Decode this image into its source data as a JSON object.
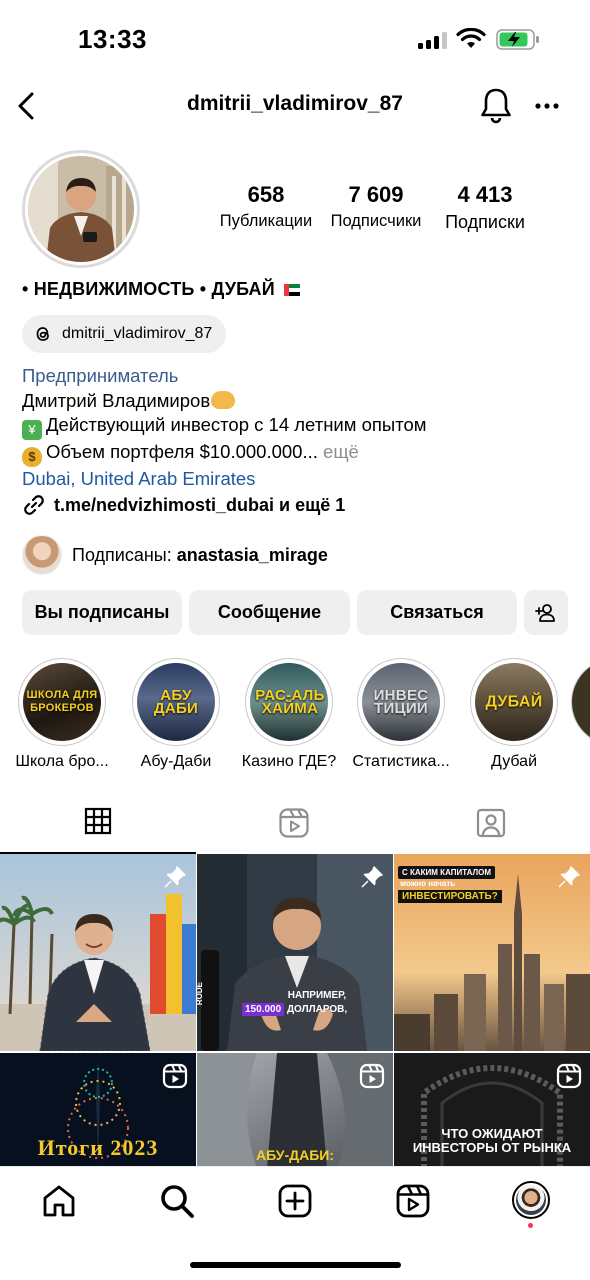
{
  "status_bar": {
    "time": "13:33"
  },
  "header": {
    "username": "dmitrii_vladimirov_87",
    "icons": [
      "back-arrow-icon",
      "bell-icon",
      "more-horizontal-icon"
    ]
  },
  "profile": {
    "stats": [
      {
        "count": "658",
        "label": "Публикации"
      },
      {
        "count": "7 609",
        "label": "Подписчики"
      },
      {
        "count": "4 413",
        "label": "Подписки"
      }
    ],
    "title": "• НЕДВИЖИМОСТЬ • ДУБАЙ",
    "threads_handle": "dmitrii_vladimirov_87",
    "category": "Предприниматель",
    "bio_line1": "Дмитрий Владимиров",
    "bio_line2": "Действующий инвестор с 14 летним опытом",
    "bio_line3": "Объем портфеля $10.000.000...",
    "bio_more": " ещё",
    "location": "Dubai, United Arab Emirates",
    "link": "t.me/nedvizhimosti_dubai и ещё 1",
    "followed_prefix": "Подписаны: ",
    "followed_user": "anastasia_mirage"
  },
  "actions": {
    "following": "Вы подписаны",
    "message": "Сообщение",
    "contact": "Связаться",
    "add_person_icon": "add-person-icon"
  },
  "highlights": [
    {
      "label": "Школа бро...",
      "cover": "ШКОЛА ДЛЯ БРОКЕРОВ"
    },
    {
      "label": "Абу-Даби",
      "cover": "АБУ ДАБИ"
    },
    {
      "label": "Казино ГДЕ?",
      "cover": "РАС-АЛЬ ХАЙМА"
    },
    {
      "label": "Статистика...",
      "cover": "ИНВЕС ТИЦИИ"
    },
    {
      "label": "Дубай",
      "cover": "ДУБАЙ"
    }
  ],
  "tabs": [
    "grid-icon",
    "reels-icon",
    "tagged-icon"
  ],
  "posts": [
    {
      "type": "pinned",
      "text": ""
    },
    {
      "type": "pinned",
      "text": "НАПРИМЕР,",
      "highlight": "150.000",
      "text2": "ДОЛЛАРОВ,",
      "mic": "RODE"
    },
    {
      "type": "pinned",
      "text_top": "С КАКИМ КАПИТАЛОМ",
      "text_mid": "можно начать",
      "text_hl": "ИНВЕСТИРОВАТЬ?"
    },
    {
      "type": "reel",
      "text": "Итоги 2023"
    },
    {
      "type": "reel",
      "text": "АБУ-ДАБИ:"
    },
    {
      "type": "reel",
      "text": "ЧТО ОЖИДАЮТ ИНВЕСТОРЫ ОТ РЫНКА"
    }
  ],
  "bottom_nav": [
    "home-icon",
    "search-icon",
    "create-icon",
    "reels-icon",
    "profile-avatar"
  ]
}
